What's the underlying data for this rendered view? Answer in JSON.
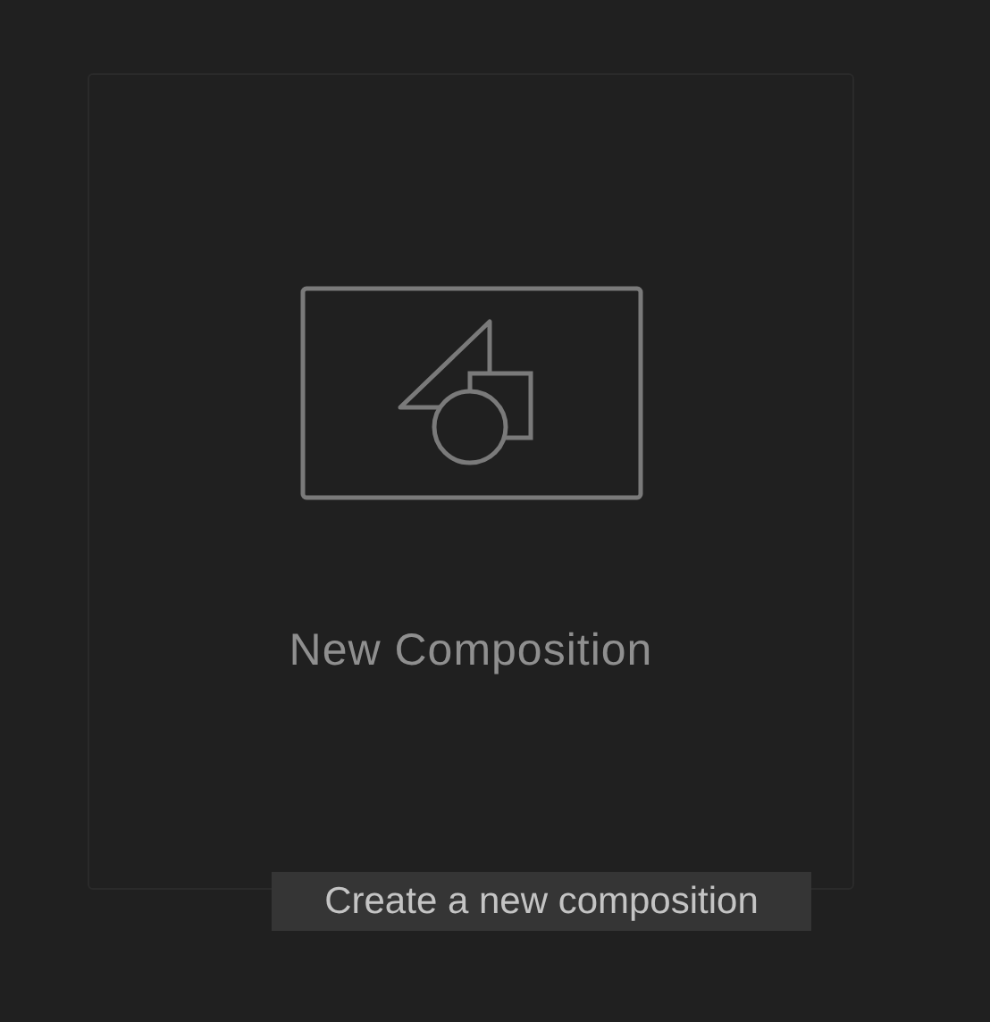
{
  "card": {
    "label": "New Composition"
  },
  "tooltip": {
    "text": "Create a new composition"
  }
}
